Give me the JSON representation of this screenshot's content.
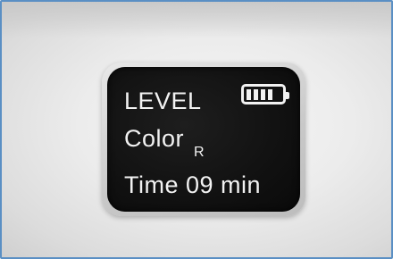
{
  "display": {
    "line1": "LEVEL",
    "line2": "Color",
    "line2_sub": "R",
    "line3": "Time 09 min"
  },
  "battery": {
    "icon": "battery-full-icon",
    "level": 1.0,
    "bars": 4
  },
  "colors": {
    "screen": "#111111",
    "text": "#f2f2f2",
    "frame_border": "#5a8fc4"
  }
}
